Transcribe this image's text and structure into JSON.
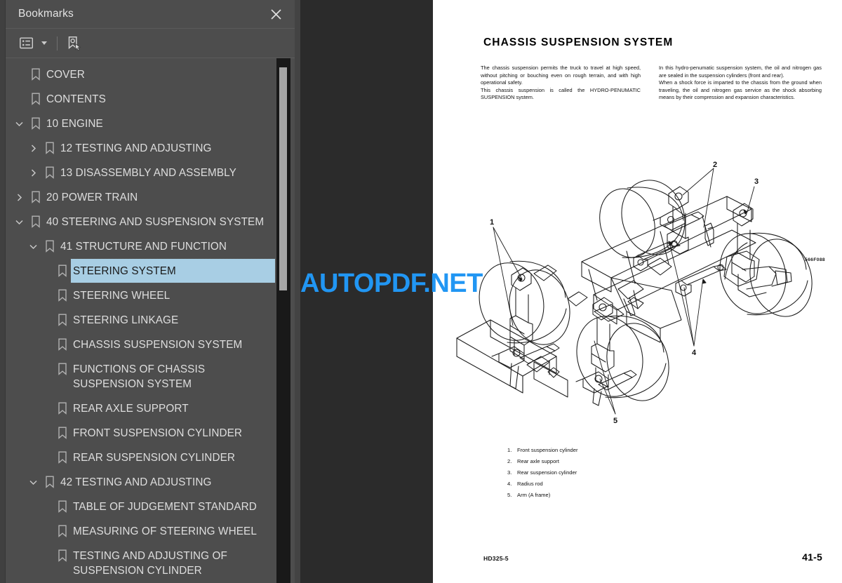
{
  "sidebar": {
    "title": "Bookmarks",
    "close_icon": "close-icon",
    "toolbar": {
      "options_icon": "list-options-icon",
      "find_icon": "find-bookmark-icon"
    },
    "selected": "STEERING SYSTEM",
    "items": [
      {
        "label": "COVER",
        "level": 0,
        "twisty": "none"
      },
      {
        "label": "CONTENTS",
        "level": 0,
        "twisty": "none"
      },
      {
        "label": "10 ENGINE",
        "level": 0,
        "twisty": "expanded"
      },
      {
        "label": "12 TESTING AND ADJUSTING",
        "level": 1,
        "twisty": "collapsed"
      },
      {
        "label": "13 DISASSEMBLY AND ASSEMBLY",
        "level": 1,
        "twisty": "collapsed"
      },
      {
        "label": "20 POWER TRAIN",
        "level": 0,
        "twisty": "collapsed"
      },
      {
        "label": "40 STEERING AND SUSPENSION SYSTEM",
        "level": 0,
        "twisty": "expanded"
      },
      {
        "label": "41 STRUCTURE AND FUNCTION",
        "level": 1,
        "twisty": "expanded"
      },
      {
        "label": "STEERING SYSTEM",
        "level": 2,
        "twisty": "none",
        "selected": true
      },
      {
        "label": "STEERING WHEEL",
        "level": 2,
        "twisty": "none"
      },
      {
        "label": "STEERING LINKAGE",
        "level": 2,
        "twisty": "none"
      },
      {
        "label": "CHASSIS SUSPENSION SYSTEM",
        "level": 2,
        "twisty": "none"
      },
      {
        "label": "FUNCTIONS OF CHASSIS SUSPENSION SYSTEM",
        "level": 2,
        "twisty": "none"
      },
      {
        "label": "REAR AXLE SUPPORT",
        "level": 2,
        "twisty": "none"
      },
      {
        "label": "FRONT SUSPENSION CYLINDER",
        "level": 2,
        "twisty": "none"
      },
      {
        "label": "REAR SUSPENSION CYLINDER",
        "level": 2,
        "twisty": "none"
      },
      {
        "label": "42 TESTING AND ADJUSTING",
        "level": 1,
        "twisty": "expanded"
      },
      {
        "label": "TABLE OF JUDGEMENT STANDARD",
        "level": 2,
        "twisty": "none"
      },
      {
        "label": "MEASURING OF STEERING WHEEL",
        "level": 2,
        "twisty": "none"
      },
      {
        "label": "TESTING AND ADJUSTING OF SUSPENSION CYLINDER",
        "level": 2,
        "twisty": "none"
      }
    ]
  },
  "watermark": {
    "text": "AUTOPDF.NET",
    "color": "#2196f3"
  },
  "page": {
    "title": "CHASSIS SUSPENSION SYSTEM",
    "column_left": "The chassis suspension permits the truck to travel at high speed, without pitching or bouching even on rough terrain, and with high operational safety. This chassis suspension is called the HYDRO-PENUMATIC SUSPENSION system.",
    "column_left_p1": "The chassis suspension permits the truck to travel at high speed, without pitching or bouching even on rough terrain, and with high operational safety.",
    "column_left_p2": "This chassis suspension is called the HYDRO-PENUMATIC SUSPENSION system.",
    "column_right_p1": "In this hydro-penumatic suspension system, the oil and nitrogen gas are sealed in the suspension cylinders (front and rear).",
    "column_right_p2": "When a shock force is imparted to the chassis from the ground when traveling, the oil and nitrogen gas service as the shock absorbing means by their compression and expansion characteristics.",
    "figure_code": "566F088",
    "callouts": [
      "1",
      "2",
      "3",
      "4",
      "5"
    ],
    "legend": [
      {
        "num": "1.",
        "text": "Front suspension cylinder"
      },
      {
        "num": "2.",
        "text": "Rear axle support"
      },
      {
        "num": "3.",
        "text": "Rear suspension cylinder"
      },
      {
        "num": "4.",
        "text": "Radius rod"
      },
      {
        "num": "5.",
        "text": "Arm (A frame)"
      }
    ],
    "footer_model": "HD325-5",
    "footer_page": "41-5"
  }
}
